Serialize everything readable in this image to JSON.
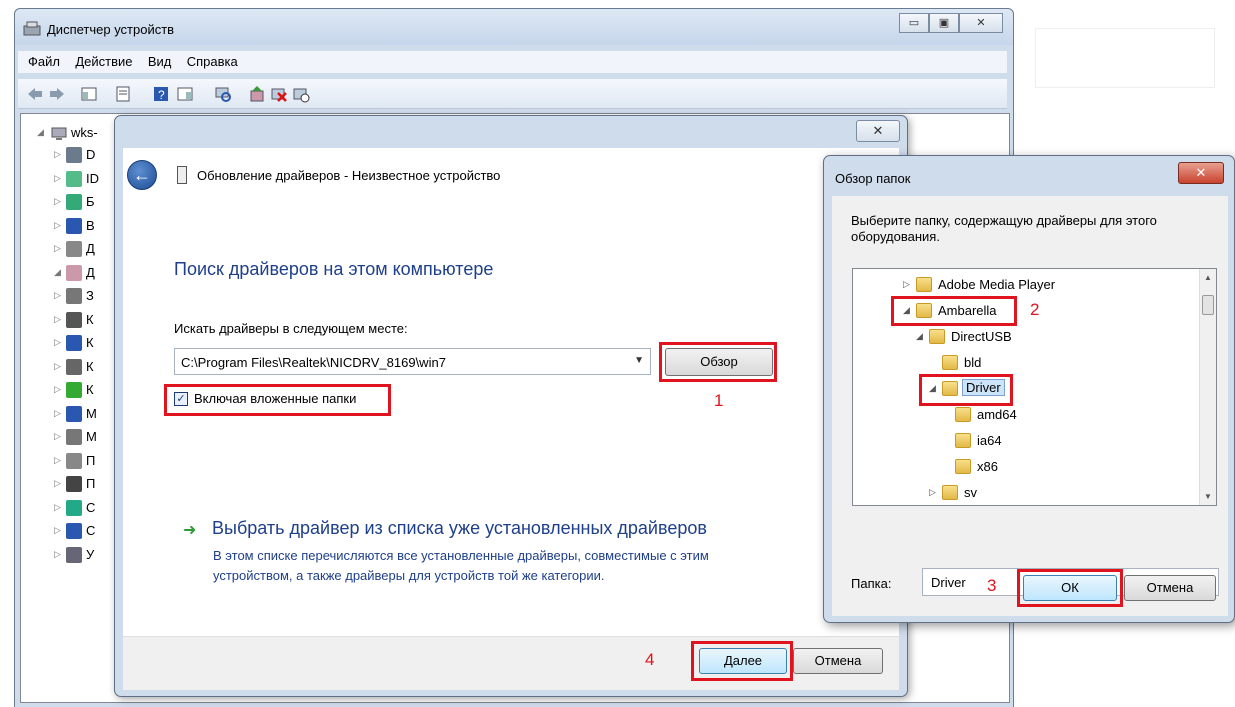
{
  "device_manager": {
    "title": "Диспетчер устройств",
    "window_buttons": [
      "▭",
      "▣",
      "✕"
    ],
    "menu": [
      "Файл",
      "Действие",
      "Вид",
      "Справка"
    ],
    "tree": {
      "root": "wks-",
      "items": [
        "D",
        "ID",
        "Б",
        "В",
        "Д",
        "Д",
        "З",
        "К",
        "К",
        "К",
        "К",
        "М",
        "М",
        "П",
        "П",
        "С",
        "С",
        "У"
      ]
    }
  },
  "wizard": {
    "close": "✕",
    "header_title": "Обновление драйверов - Неизвестное устройство",
    "heading": "Поиск драйверов на этом компьютере",
    "search_label": "Искать драйверы в следующем месте:",
    "path": "C:\\Program Files\\Realtek\\NICDRV_8169\\win7",
    "browse_button": "Обзор",
    "include_subfolders": "Включая вложенные папки",
    "pick_link": "Выбрать драйвер из списка уже установленных драйверов",
    "pick_description": "В этом списке перечисляются все установленные драйверы, совместимые с этим устройством, а также драйверы для устройств той же категории.",
    "next_button": "Далее",
    "cancel_button": "Отмена"
  },
  "browse_dialog": {
    "title": "Обзор папок",
    "close": "✕",
    "prompt": "Выберите папку, содержащую драйверы для этого оборудования.",
    "tree": [
      "Adobe Media Player",
      "Ambarella",
      "DirectUSB",
      "bld",
      "Driver",
      "amd64",
      "ia64",
      "x86",
      "sv"
    ],
    "folder_label": "Папка:",
    "folder_value": "Driver",
    "ok_button": "ОК",
    "cancel_button": "Отмена"
  },
  "annotations": [
    "1",
    "2",
    "3",
    "4"
  ],
  "colors": {
    "highlight": "#e0141e",
    "link": "#1e3f8a"
  }
}
